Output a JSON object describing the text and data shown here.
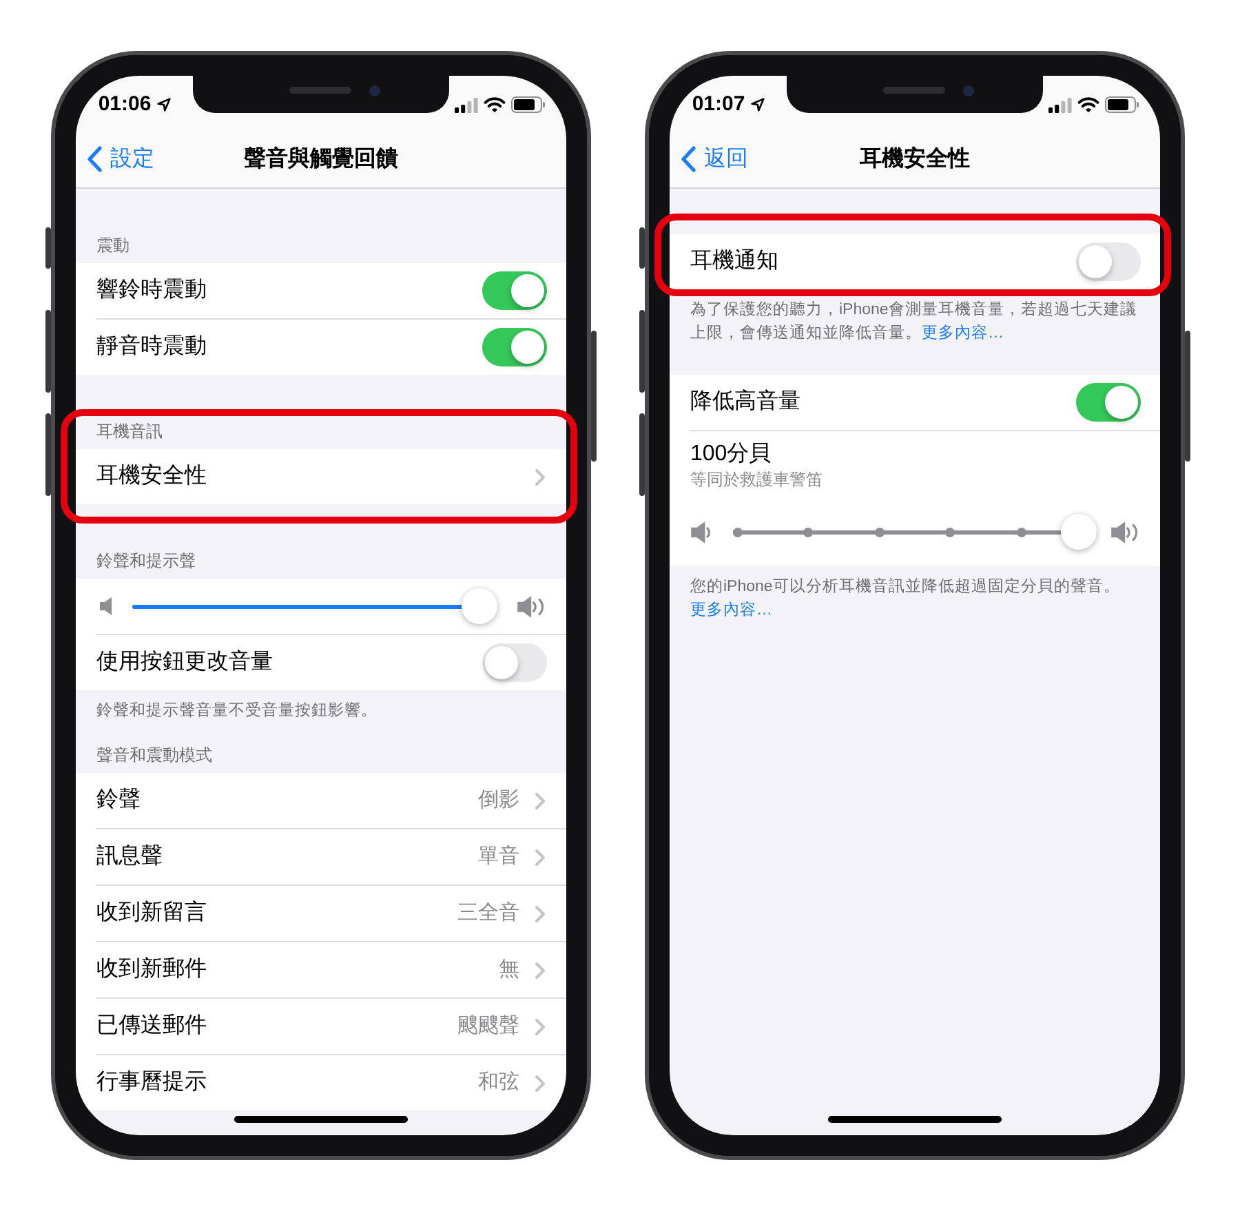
{
  "phones": [
    {
      "status_bar": {
        "time": "01:06"
      },
      "nav_bar": {
        "back": "設定",
        "title": "聲音與觸覺回饋"
      },
      "sections": [
        {
          "header": "震動",
          "highlighted": false,
          "rows": [
            {
              "kind": "toggle",
              "label": "響鈴時震動",
              "on": true
            },
            {
              "kind": "toggle",
              "label": "靜音時震動",
              "on": true
            }
          ]
        },
        {
          "header": "耳機音訊",
          "highlighted": true,
          "rows": [
            {
              "kind": "link",
              "label": "耳機安全性"
            }
          ]
        },
        {
          "header": "鈴聲和提示聲",
          "highlighted": false,
          "rows": [
            {
              "kind": "slider",
              "level": 1
            },
            {
              "kind": "toggle",
              "label": "使用按鈕更改音量",
              "on": false
            }
          ],
          "footer": {
            "text": "鈴聲和提示聲音量不受音量按鈕影響。"
          }
        },
        {
          "header": "聲音和震動模式",
          "highlighted": false,
          "rows": [
            {
              "kind": "link",
              "label": "鈴聲",
              "value": "倒影"
            },
            {
              "kind": "link",
              "label": "訊息聲",
              "value": "單音"
            },
            {
              "kind": "link",
              "label": "收到新留言",
              "value": "三全音"
            },
            {
              "kind": "link",
              "label": "收到新郵件",
              "value": "無"
            },
            {
              "kind": "link",
              "label": "已傳送郵件",
              "value": "颼颼聲"
            },
            {
              "kind": "link",
              "label": "行事曆提示",
              "value": "和弦"
            }
          ]
        }
      ]
    },
    {
      "status_bar": {
        "time": "01:07"
      },
      "nav_bar": {
        "back": "返回",
        "title": "耳機安全性"
      },
      "sections": [
        {
          "highlighted": true,
          "rows": [
            {
              "kind": "toggle",
              "label": "耳機通知",
              "on": false
            }
          ],
          "footer": {
            "text": "為了保護您的聽力，iPhone會測量耳機音量，若超過七天建議上限，會傳送通知並降低音量。",
            "link": "更多內容…"
          }
        },
        {
          "highlighted": false,
          "rows": [
            {
              "kind": "toggle",
              "label": "降低高音量",
              "on": true
            },
            {
              "kind": "level",
              "title": "100分貝",
              "subtitle": "等同於救護車警笛",
              "level": 1
            }
          ],
          "footer": {
            "text": "您的iPhone可以分析耳機音訊並降低超過固定分貝的聲音。",
            "link": "更多內容…"
          }
        }
      ]
    }
  ]
}
